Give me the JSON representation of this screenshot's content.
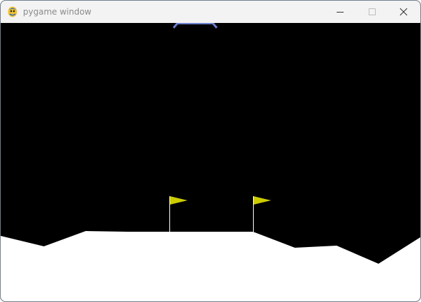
{
  "window": {
    "title": "pygame window"
  },
  "titlebar_buttons": {
    "minimize": "minimize-icon",
    "maximize": "maximize-icon",
    "close": "close-icon"
  },
  "scene": {
    "sky_color": "#000000",
    "terrain_color": "#ffffff",
    "flag_color": "#cccc00",
    "pole_color": "#ffffff",
    "lander_leg_color": "#6b7fcf",
    "flag_count": 2
  }
}
